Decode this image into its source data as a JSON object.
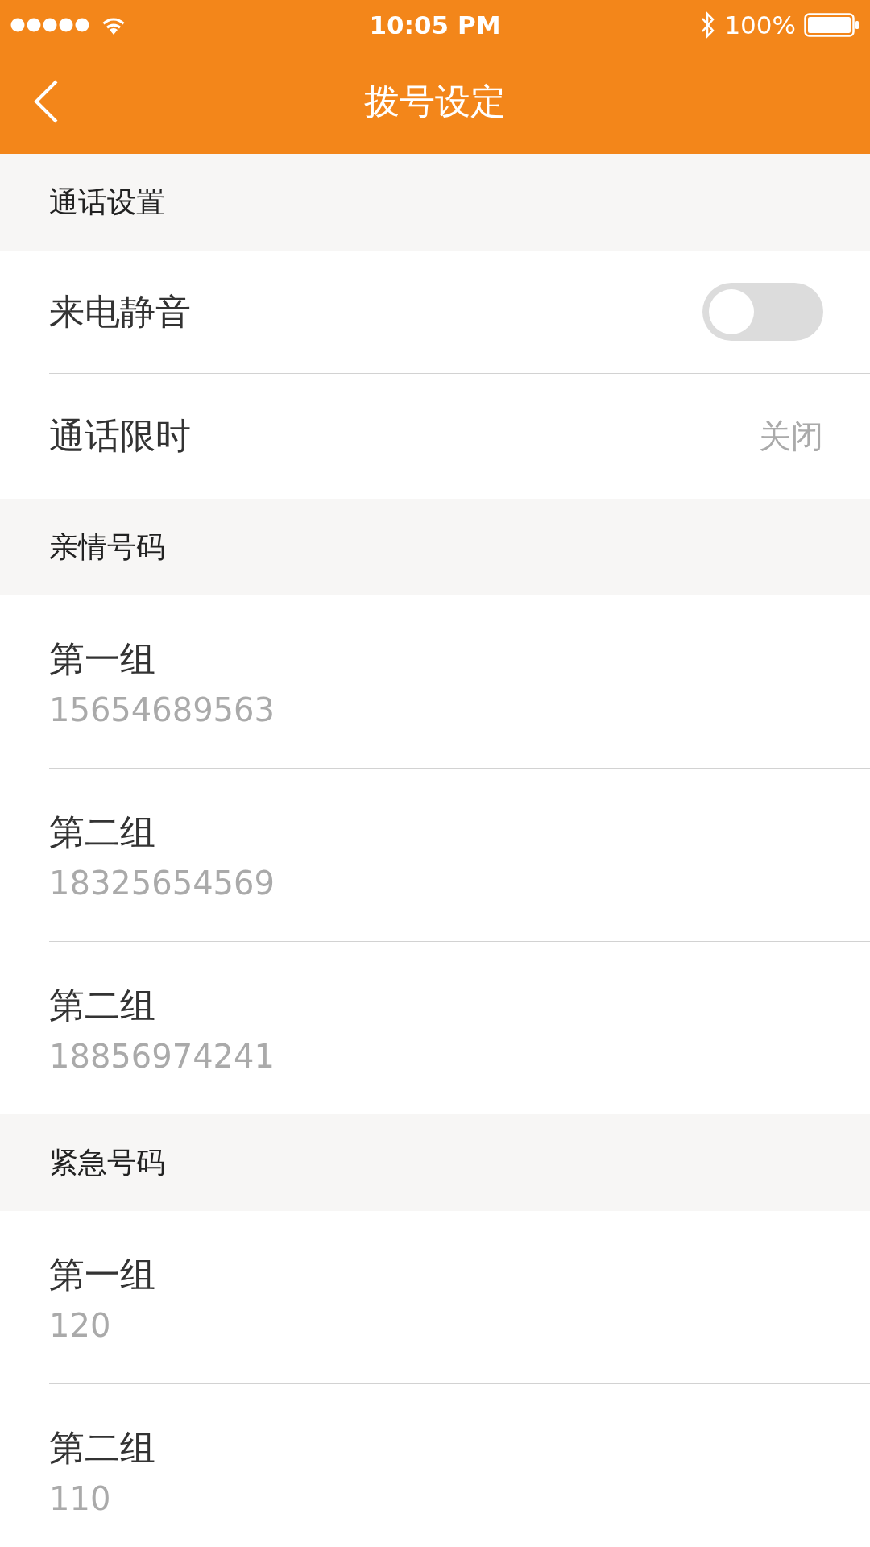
{
  "status_bar": {
    "time": "10:05 PM",
    "battery": "100%"
  },
  "nav": {
    "title": "拨号设定"
  },
  "sections": [
    {
      "title": "通话设置",
      "items": [
        {
          "kind": "toggle",
          "label": "来电静音",
          "on": false
        },
        {
          "kind": "value",
          "label": "通话限时",
          "value": "关闭"
        }
      ]
    },
    {
      "title": "亲情号码",
      "items": [
        {
          "kind": "contact",
          "label": "第一组",
          "number": "15654689563"
        },
        {
          "kind": "contact",
          "label": "第二组",
          "number": "18325654569"
        },
        {
          "kind": "contact",
          "label": "第二组",
          "number": "18856974241"
        }
      ]
    },
    {
      "title": "紧急号码",
      "items": [
        {
          "kind": "contact",
          "label": "第一组",
          "number": "120"
        },
        {
          "kind": "contact",
          "label": "第二组",
          "number": "110"
        }
      ]
    }
  ]
}
